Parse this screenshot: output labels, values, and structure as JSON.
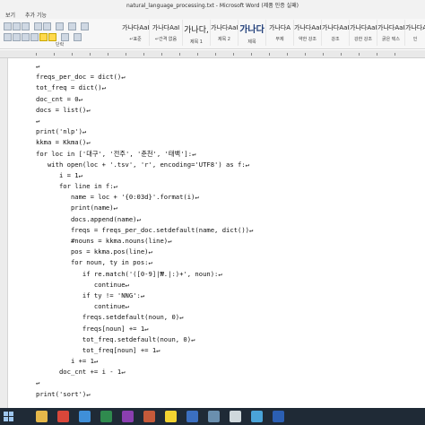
{
  "window": {
    "title": "natural_language_processing.txt - Microsoft Word (제품 인증 실패)"
  },
  "menu": {
    "items": [
      "보기",
      "추가 기능"
    ]
  },
  "ribbon": {
    "group_label": "단락",
    "styles": [
      {
        "preview": "가나다AaI",
        "name": "↵표준"
      },
      {
        "preview": "가나다AaI",
        "name": "↵간격 없음"
      },
      {
        "preview": "가나다,",
        "name": "제목 1"
      },
      {
        "preview": "가나다AaI",
        "name": "제목 2"
      },
      {
        "preview": "가나다",
        "name": "제목"
      },
      {
        "preview": "가나다A",
        "name": "부제"
      },
      {
        "preview": "가나다AaI",
        "name": "약한 강조"
      },
      {
        "preview": "가나다AaI",
        "name": "강조"
      },
      {
        "preview": "가나다AaI",
        "name": "강한 강조"
      },
      {
        "preview": "가나다AaI",
        "name": "굵은 텍스"
      },
      {
        "preview": "가나다AaI",
        "name": "인"
      }
    ]
  },
  "document": {
    "lines": [
      "↵",
      "freqs_per_doc = dict()↵",
      "tot_freq = dict()↵",
      "doc_cnt = 0↵",
      "docs = list()↵",
      "↵",
      "print('nlp')↵",
      "kkma = Kkma()↵",
      "for loc in ['대구', '전주', '춘천', '태백']:↵",
      "   with open(loc + '.tsv', 'r', encoding='UTF8') as f:↵",
      "      i = 1↵",
      "      for line in f:↵",
      "         name = loc + '{0:03d}'.format(i)↵",
      "         print(name)↵",
      "         docs.append(name)↵",
      "         freqs = freqs_per_doc.setdefault(name, dict())↵",
      "         #nouns = kkma.nouns(line)↵",
      "         pos = kkma.pos(line)↵",
      "         for noun, ty in pos:↵",
      "            if re.match('([0-9]|₩.|:)+', noun):↵",
      "               continue↵",
      "            if ty != 'NNG':↵",
      "               continue↵",
      "            freqs.setdefault(noun, 0)↵",
      "            freqs[noun] += 1↵",
      "            tot_freq.setdefault(noun, 0)↵",
      "            tot_freq[noun] += 1↵",
      "         i += 1↵",
      "      doc_cnt += i - 1↵",
      "↵",
      "print('sort')↵"
    ]
  },
  "taskbar": {
    "apps": [
      {
        "icon": "folder-icon",
        "color": "#e6b84a"
      },
      {
        "icon": "chrome-icon",
        "color": "#d9473a"
      },
      {
        "icon": "media-icon",
        "color": "#3f8fd8"
      },
      {
        "icon": "excel-icon",
        "color": "#2f8a4e"
      },
      {
        "icon": "onenote-icon",
        "color": "#8a3fb0"
      },
      {
        "icon": "app-icon",
        "color": "#c55a3a"
      },
      {
        "icon": "kakaotalk-icon",
        "color": "#f3d331"
      },
      {
        "icon": "app-icon",
        "color": "#3b6fc0"
      },
      {
        "icon": "app-icon",
        "color": "#6a8fae"
      },
      {
        "icon": "app-icon",
        "color": "#cfd8dc"
      },
      {
        "icon": "app-icon",
        "color": "#4aa3d8"
      },
      {
        "icon": "word-icon",
        "color": "#2b5fb3"
      }
    ]
  }
}
